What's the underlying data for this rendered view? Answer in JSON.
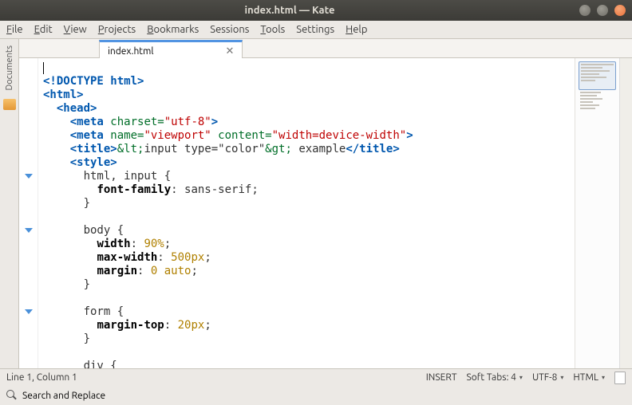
{
  "window": {
    "title": "index.html — Kate"
  },
  "menubar": [
    {
      "key": "F",
      "rest": "ile"
    },
    {
      "key": "E",
      "rest": "dit"
    },
    {
      "key": "V",
      "rest": "iew"
    },
    {
      "key": "P",
      "rest": "rojects"
    },
    {
      "key": "B",
      "rest": "ookmarks"
    },
    {
      "key": "",
      "rest": "Sessions"
    },
    {
      "key": "T",
      "rest": "ools"
    },
    {
      "key": "",
      "rest": "Settings"
    },
    {
      "key": "H",
      "rest": "elp"
    }
  ],
  "side_panel": {
    "label": "Documents"
  },
  "tab": {
    "label": "index.html"
  },
  "code": {
    "l1": "",
    "l2_doctype": "<!DOCTYPE",
    "l2_html": " html",
    "l2_close": ">",
    "l3_open": "<html>",
    "l4_head": "<head>",
    "l5_meta": "<meta",
    "l5_attr": " charset=",
    "l5_val": "\"utf-8\"",
    "l5_close": ">",
    "l6_meta": "<meta",
    "l6_a1": " name=",
    "l6_v1": "\"viewport\"",
    "l6_a2": " content=",
    "l6_v2": "\"width=device-width\"",
    "l6_close": ">",
    "l7_to": "<title>",
    "l7_e1": "&lt;",
    "l7_txt": "input type=\"color\"",
    "l7_e2": "&gt;",
    "l7_txt2": " example",
    "l7_tc": "</title>",
    "l8_style": "<style>",
    "l9": "      html, input {",
    "l10_prop": "font-family",
    "l10_sep": ": ",
    "l10_val": "sans-serif",
    "l10_semi": ";",
    "l11": "      }",
    "l12": "",
    "l13": "      body {",
    "l14_p": "width",
    "l14_v": "90%",
    "l15_p": "max-width",
    "l15_v": "500px",
    "l16_p": "margin",
    "l16_v1": "0",
    "l16_v2": " auto",
    "l17": "      }",
    "l18": "",
    "l19": "      form {",
    "l20_p": "margin-top",
    "l20_v": "20px",
    "l21": "      }",
    "l22": "",
    "l23": "      div {"
  },
  "status": {
    "position": "Line 1, Column 1",
    "mode": "INSERT",
    "tabs": "Soft Tabs: 4",
    "encoding": "UTF-8",
    "lang": "HTML"
  },
  "search": {
    "label": "Search and Replace"
  }
}
